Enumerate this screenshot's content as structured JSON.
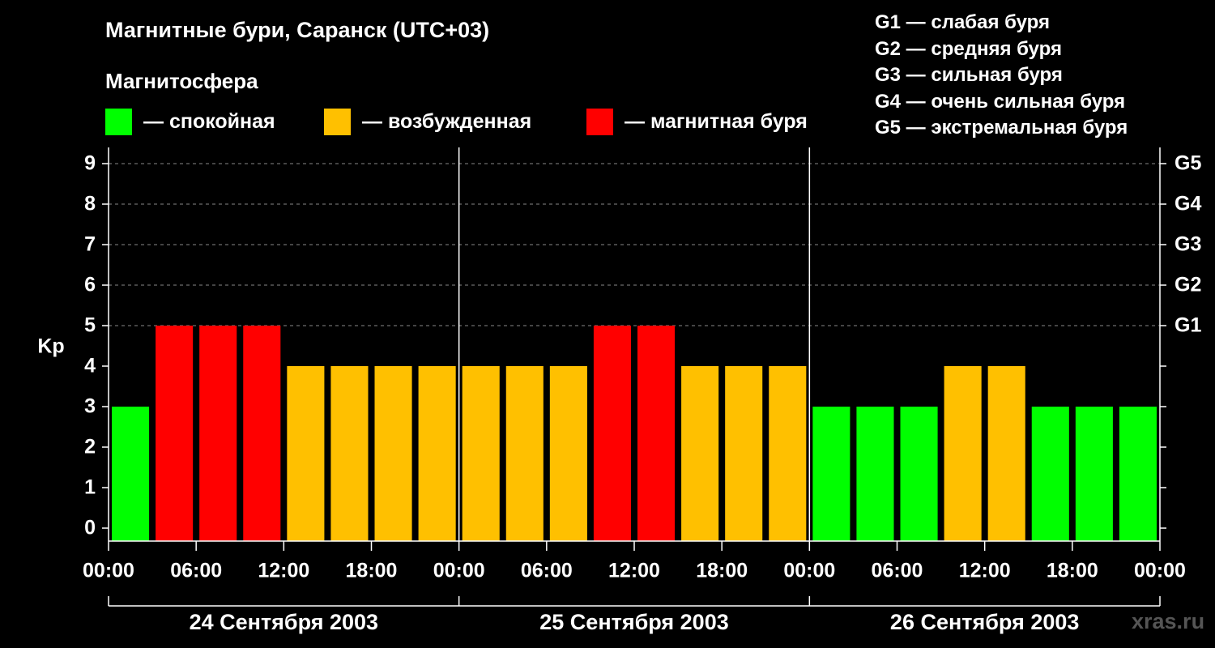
{
  "title": "Магнитные бури, Саранск (UTC+03)",
  "subtitle": "Магнитосфера",
  "legend": [
    {
      "label": "— спокойная",
      "color": "#00ff00"
    },
    {
      "label": "— возбужденная",
      "color": "#ffc000"
    },
    {
      "label": "— магнитная буря",
      "color": "#ff0000"
    }
  ],
  "g_legend": [
    "G1 — слабая буря",
    "G2 — средняя буря",
    "G3 — сильная буря",
    "G4 — очень сильная буря",
    "G5 — экстремальная буря"
  ],
  "watermark": "xras.ru",
  "chart_data": {
    "type": "bar",
    "ylabel": "Kp",
    "ylim": [
      0,
      9
    ],
    "yticks": [
      "0",
      "1",
      "2",
      "3",
      "4",
      "5",
      "6",
      "7",
      "8",
      "9"
    ],
    "right_ticks": [
      {
        "kp": 5,
        "label": "G1"
      },
      {
        "kp": 6,
        "label": "G2"
      },
      {
        "kp": 7,
        "label": "G3"
      },
      {
        "kp": 8,
        "label": "G4"
      },
      {
        "kp": 9,
        "label": "G5"
      }
    ],
    "grid": "dashed horizontal at each Kp level 5-9",
    "xticks": [
      "00:00",
      "06:00",
      "12:00",
      "18:00",
      "00:00",
      "06:00",
      "12:00",
      "18:00",
      "00:00",
      "06:00",
      "12:00",
      "18:00",
      "00:00"
    ],
    "days": [
      "24 Сентября 2003",
      "25 Сентября 2003",
      "26 Сентября 2003"
    ],
    "interval_hours": 3,
    "values": [
      3,
      5,
      5,
      5,
      4,
      4,
      4,
      4,
      4,
      4,
      4,
      5,
      5,
      4,
      4,
      4,
      3,
      3,
      3,
      4,
      4,
      3,
      3,
      3
    ],
    "colors": {
      "quiet": "#00ff00",
      "active": "#ffc000",
      "storm": "#ff0000"
    }
  }
}
